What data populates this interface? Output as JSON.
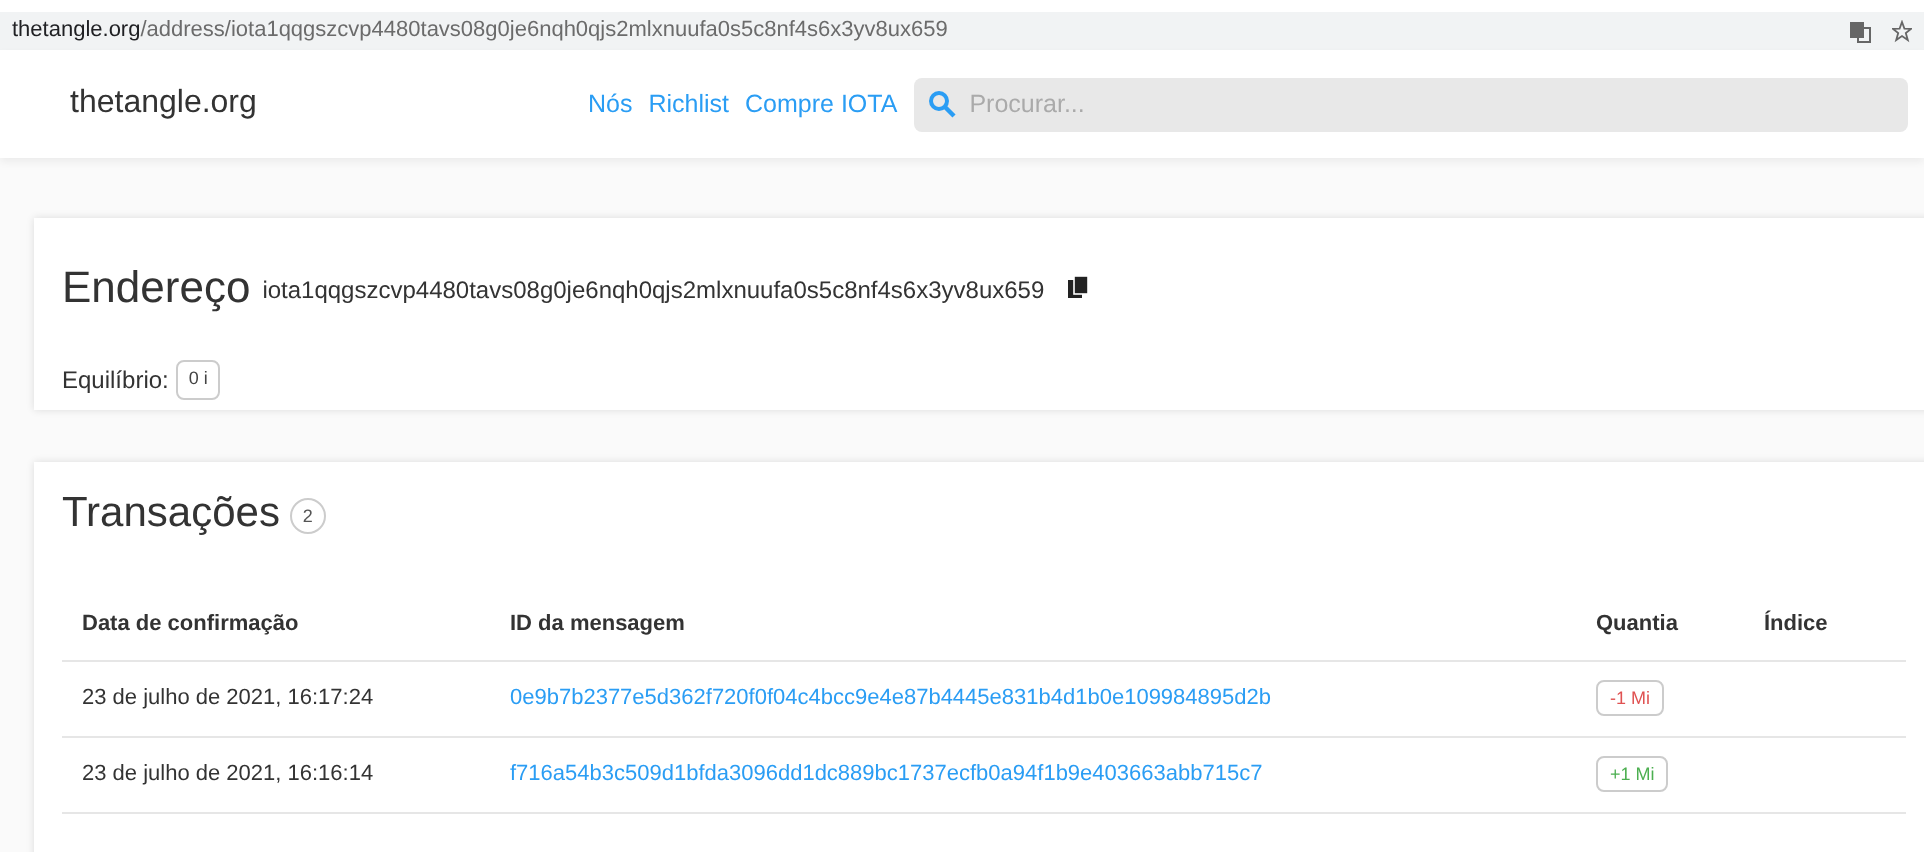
{
  "browser": {
    "url_host": "thetangle.org",
    "url_path": "/address/iota1qqgszcvp4480tavs08g0je6nqh0qjs2mlxnuufa0s5c8nf4s6x3yv8ux659"
  },
  "header": {
    "logo": "thetangle.org",
    "nav": [
      "Nós",
      "Richlist",
      "Compre IOTA"
    ],
    "search": {
      "placeholder": "Procurar..."
    }
  },
  "address_card": {
    "title": "Endereço",
    "address": "iota1qqgszcvp4480tavs08g0je6nqh0qjs2mlxnuufa0s5c8nf4s6x3yv8ux659",
    "balance_label": "Equilíbrio:",
    "balance": "0 i"
  },
  "transactions": {
    "title": "Transações",
    "count": "2",
    "columns": [
      "Data de confirmação",
      "ID da mensagem",
      "Quantia",
      "Índice"
    ],
    "rows": [
      {
        "date": "23 de julho de 2021, 16:17:24",
        "message_id": "0e9b7b2377e5d362f720f0f04c4bcc9e4e87b4445e831b4d1b0e109984895d2b",
        "amount": "-1 Mi",
        "kind": "debit"
      },
      {
        "date": "23 de julho de 2021, 16:16:14",
        "message_id": "f716a54b3c509d1bfda3096dd1dc889bc1737ecfb0a94f1b9e403663abb715c7",
        "amount": "+1 Mi",
        "kind": "credit"
      }
    ]
  }
}
